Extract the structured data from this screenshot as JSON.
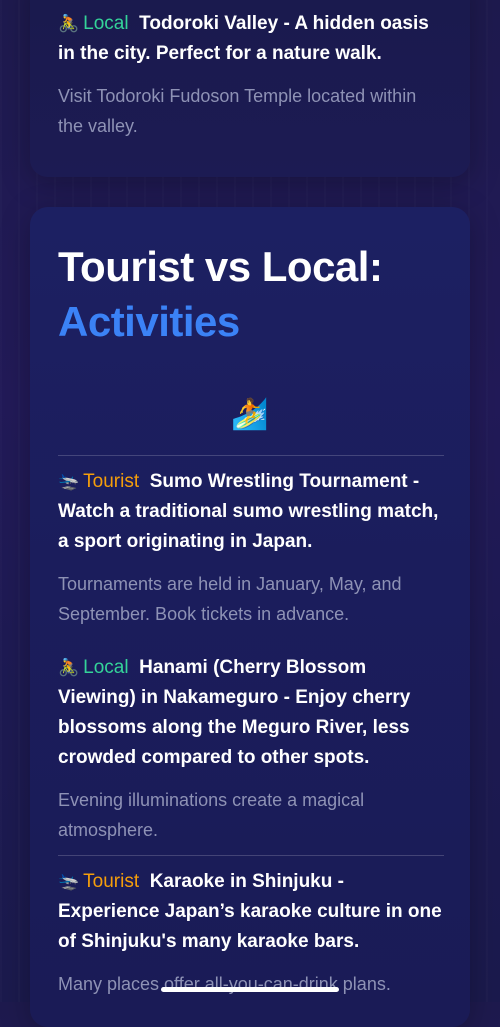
{
  "top_card": {
    "entry": {
      "emoji": "🚴",
      "tag": "Local",
      "title": "Todoroki Valley - A hidden oasis in the city. Perfect for a nature walk.",
      "note": "Visit Todoroki Fudoson Temple located within the valley."
    }
  },
  "section": {
    "title_line1": "Tourist vs Local:",
    "title_line2": "Activities",
    "hero_emoji": "🏄",
    "entries": [
      {
        "emoji": "🛬",
        "tag": "Tourist",
        "title": "Sumo Wrestling Tournament - Watch a traditional sumo wrestling match, a sport originating in Japan.",
        "note": "Tournaments are held in January, May, and September. Book tickets in advance."
      },
      {
        "emoji": "🚴",
        "tag": "Local",
        "title": "Hanami (Cherry Blossom Viewing) in Nakameguro - Enjoy cherry blossoms along the Meguro River, less crowded compared to other spots.",
        "note": "Evening illuminations create a magical atmosphere."
      },
      {
        "emoji": "🛬",
        "tag": "Tourist",
        "title": "Karaoke in Shinjuku - Experience Japan’s karaoke culture in one of Shinjuku's many karaoke bars.",
        "note": "Many places offer all-you-can-drink plans."
      }
    ]
  },
  "colors": {
    "local_tag": "#34d399",
    "tourist_tag": "#f59e0b",
    "accent_title": "#3b82f6",
    "note_text": "#8e92b5"
  }
}
